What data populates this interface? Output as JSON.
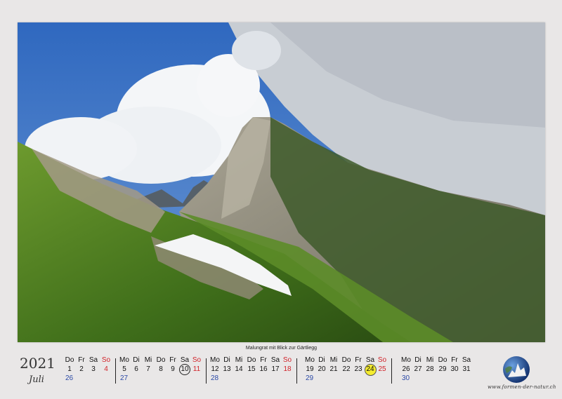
{
  "caption": "Malungrat mit Blick zur Gärtliegg",
  "year": "2021",
  "month": "Juli",
  "weekday_heads": [
    "Do",
    "Fr",
    "Sa",
    "So",
    "Mo",
    "Di",
    "Mi",
    "Do",
    "Fr",
    "Sa",
    "So",
    "Mo",
    "Di",
    "Mi",
    "Do",
    "Fr",
    "Sa",
    "So",
    "Mo",
    "Di",
    "Mi",
    "Do",
    "Fr",
    "Sa",
    "So",
    "Mo",
    "Di",
    "Mi",
    "Do",
    "Fr",
    "Sa"
  ],
  "days": [
    "1",
    "2",
    "3",
    "4",
    "5",
    "6",
    "7",
    "8",
    "9",
    "10",
    "11",
    "12",
    "13",
    "14",
    "15",
    "16",
    "17",
    "18",
    "19",
    "20",
    "21",
    "22",
    "23",
    "24",
    "25",
    "26",
    "27",
    "28",
    "29",
    "30",
    "31"
  ],
  "weeks": [
    "26",
    "27",
    "28",
    "29",
    "30"
  ],
  "circled_day": "10",
  "highlighted_day": "24",
  "colors": {
    "sunday": "#d1232a",
    "week_number": "#2c4aa6",
    "highlight": "#f5ec2f"
  },
  "website": "www.formen-der-natur.ch"
}
